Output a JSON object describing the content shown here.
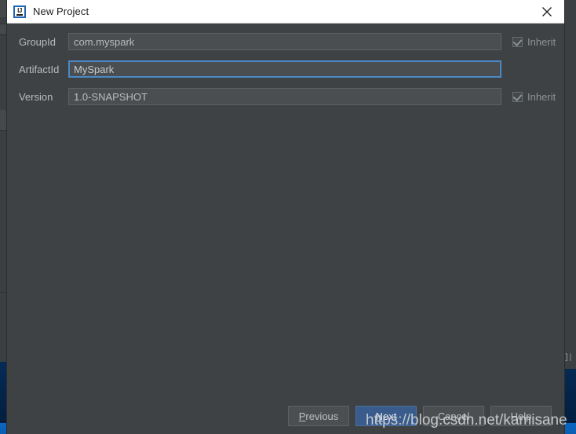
{
  "window": {
    "title": "New Project",
    "app_icon": "intellij-idea-icon",
    "icon_letters": "IJ",
    "close_icon": "close-icon"
  },
  "form": {
    "rows": [
      {
        "label": "GroupId",
        "value": "com.myspark",
        "placeholder": "",
        "focused": false,
        "inherit": {
          "label": "Inherit",
          "checked": true,
          "visible": true
        }
      },
      {
        "label": "ArtifactId",
        "value": "MySpark",
        "placeholder": "",
        "focused": true,
        "inherit": {
          "label": "",
          "checked": false,
          "visible": false
        }
      },
      {
        "label": "Version",
        "value": "1.0-SNAPSHOT",
        "placeholder": "",
        "focused": false,
        "inherit": {
          "label": "Inherit",
          "checked": true,
          "visible": true
        }
      }
    ]
  },
  "footer": {
    "buttons": [
      {
        "label": "Previous",
        "mnemonic": "P",
        "rest": "revious",
        "default": false
      },
      {
        "label": "Next",
        "mnemonic": "N",
        "rest": "ext",
        "default": true
      },
      {
        "label": "Cancel",
        "mnemonic": "",
        "rest": "Cancel",
        "default": false
      },
      {
        "label": "Help",
        "mnemonic": "",
        "rest": "Help",
        "default": false
      }
    ]
  },
  "watermark": {
    "text": "https://blog.csdn.net/kamisane"
  },
  "background": {
    "right_strip_glyph": "]|",
    "taskbar_icon": "firefox-icon"
  },
  "colors": {
    "dialog_bg": "#3e4244",
    "field_bg": "#4a4e50",
    "focus_border": "#4a88c7",
    "default_button": "#3a5c8c",
    "titlebar_bg": "#ffffff",
    "desktop_blue": "#0b4a93"
  }
}
